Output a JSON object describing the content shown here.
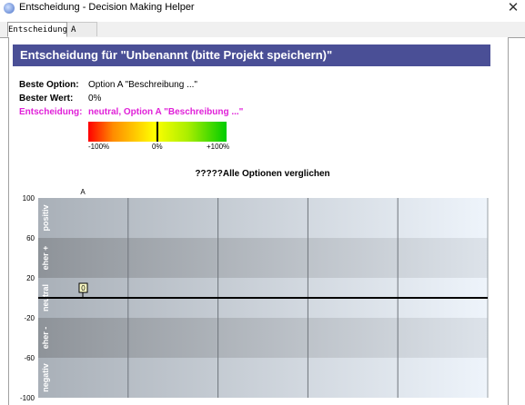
{
  "window": {
    "title": "Entscheidung - Decision Making Helper",
    "close_glyph": "✕"
  },
  "tabs": [
    {
      "label": "Entscheidung"
    },
    {
      "label": "A"
    }
  ],
  "header": {
    "title": "Entscheidung für  \"Unbenannt (bitte Projekt speichern)\""
  },
  "summary": {
    "best_option_label": "Beste Option:",
    "best_option_value": "Option A \"Beschreibung ...\"",
    "best_value_label": "Bester Wert:",
    "best_value_value": "0%",
    "decision_label": "Entscheidung:",
    "decision_value": "neutral, Option A \"Beschreibung ...\""
  },
  "scale": {
    "min_label": "-100%",
    "mid_label": "0%",
    "max_label": "+100%",
    "current_value": 0
  },
  "colors": {
    "header_band": "#4a4f96",
    "decision_text": "#e020d8"
  },
  "chart_data": {
    "type": "scatter",
    "title": "?????Alle Optionen verglichen",
    "categories": [
      "A"
    ],
    "series": [
      {
        "values": [
          0
        ],
        "labels": [
          "0"
        ]
      }
    ],
    "ylim": [
      -100,
      100
    ],
    "yticks": [
      100,
      60,
      20,
      -20,
      -60,
      -100
    ],
    "bands": [
      {
        "label": "positiv",
        "from": 60,
        "to": 100
      },
      {
        "label": "eher +",
        "from": 20,
        "to": 60
      },
      {
        "label": "neutral",
        "from": -20,
        "to": 20
      },
      {
        "label": "eher -",
        "from": -60,
        "to": -20
      },
      {
        "label": "negativ",
        "from": -100,
        "to": -60
      }
    ],
    "grid": true
  }
}
